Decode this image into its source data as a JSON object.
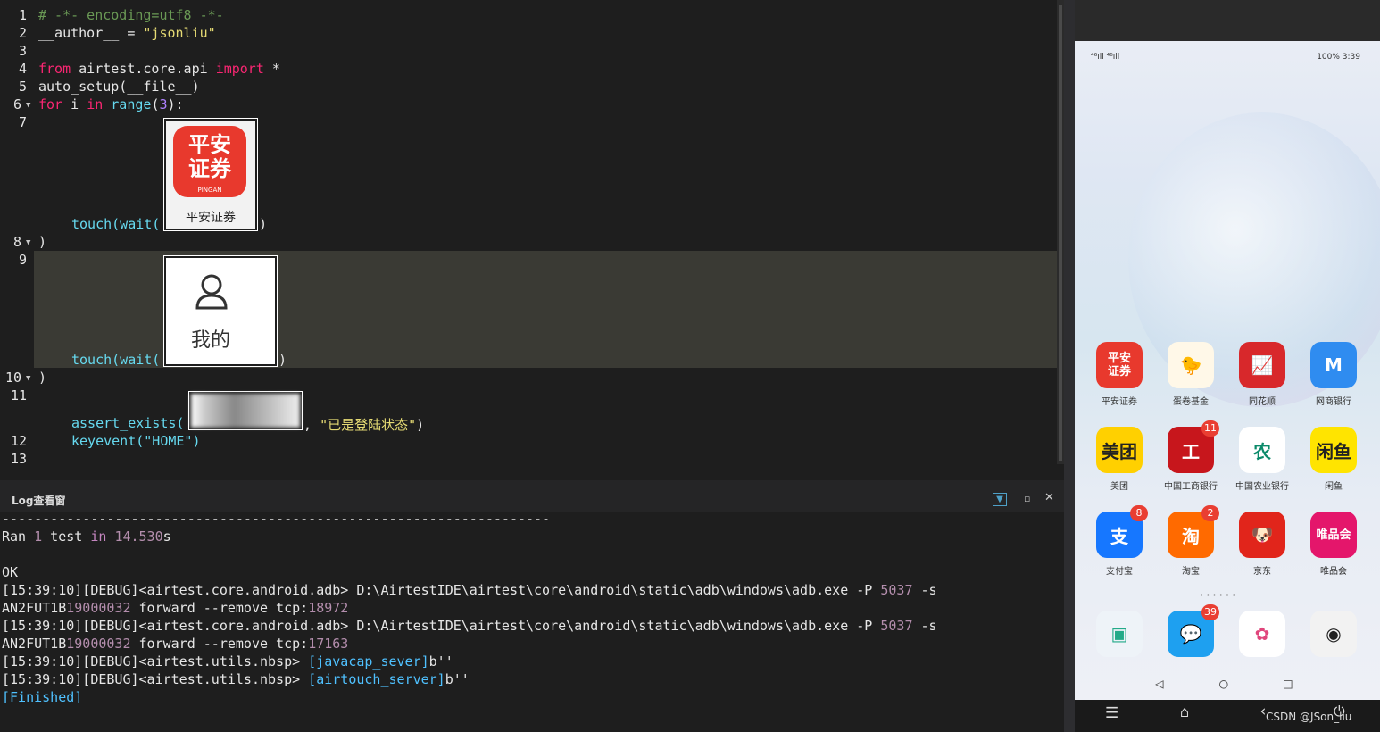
{
  "editor": {
    "line_numbers": [
      "1",
      "2",
      "3",
      "4",
      "5",
      "6",
      "7",
      "8",
      "9",
      "10",
      "11",
      "12",
      "13"
    ],
    "l1": "# -*- encoding=utf8 -*-",
    "l2a": "__author__ = ",
    "l2b": "\"jsonliu\"",
    "l4a": "from",
    "l4b": " airtest.core.api ",
    "l4c": "import",
    "l4d": " *",
    "l5": "auto_setup(__file__)",
    "l6a": "for",
    "l6b": " i ",
    "l6c": "in",
    "l6d": " range",
    "l6e": "(",
    "l6f": "3",
    "l6g": "):",
    "touch": "touch",
    "wait": "(wait(",
    "close": ")",
    "paren": ")",
    "assert": "assert_exists(",
    "assert_msg": "\"已是登陆状态\"",
    "assert_end": ")",
    "comma": ", ",
    "keyevent": "keyevent(\"HOME\")",
    "img1_text": "平安证券",
    "img1_icon": "平安\n证券",
    "img1_sub": "PINGAN",
    "img2_text": "我的"
  },
  "log": {
    "title": "Log查看窗",
    "dashes": "--------------------------------------------------------------------",
    "ran_a": "Ran ",
    "ran_b": "1",
    "ran_c": " test ",
    "ran_d": "in",
    "ran_e": " ",
    "ran_f": "14.530",
    "ran_g": "s",
    "ok": "OK",
    "l1a": "[15:39:10][DEBUG]<airtest.core.android.adb> D:\\AirtestIDE\\airtest\\core\\android\\static\\adb\\windows\\adb.exe -P ",
    "l1b": "5037",
    "l1c": " -s",
    "l2a": "AN2FUT1B",
    "l2b": "19000032",
    "l2c": " forward --remove tcp:",
    "l2d": "18972",
    "l3a": "[15:39:10][DEBUG]<airtest.core.android.adb> D:\\AirtestIDE\\airtest\\core\\android\\static\\adb\\windows\\adb.exe -P ",
    "l3b": "5037",
    "l3c": " -s",
    "l4a": "AN2FUT1B",
    "l4b": "19000032",
    "l4c": " forward --remove tcp:",
    "l4d": "17163",
    "l5a": "[15:39:10][DEBUG]<airtest.utils.nbsp> ",
    "l5b": "[javacap_sever]",
    "l5c": "b''",
    "l6a": "[15:39:10][DEBUG]<airtest.utils.nbsp> ",
    "l6b": "[airtouch_server]",
    "l6c": "b''",
    "finished": "[Finished]"
  },
  "phone": {
    "status_left": "⁴⁶ıll ⁴⁶ıll",
    "status_right": "100%  3:39",
    "apps": [
      {
        "label": "平安证券",
        "icon": "平安\n证券",
        "bg": "#e8392d",
        "fg": "#fff"
      },
      {
        "label": "蛋卷基金",
        "icon": "🐤",
        "bg": "#fff8e8",
        "fg": "#f5c400"
      },
      {
        "label": "同花顺",
        "icon": "📈",
        "bg": "#d8282b",
        "fg": "#fff"
      },
      {
        "label": "网商银行",
        "icon": "M",
        "bg": "#2f8cf0",
        "fg": "#fff"
      },
      {
        "label": "美团",
        "icon": "美团",
        "bg": "#ffd000",
        "fg": "#222"
      },
      {
        "label": "中国工商银行",
        "icon": "工",
        "bg": "#c7161c",
        "fg": "#fff",
        "badge": "11"
      },
      {
        "label": "中国农业银行",
        "icon": "农",
        "bg": "#ffffff",
        "fg": "#0b8a6a"
      },
      {
        "label": "闲鱼",
        "icon": "闲鱼",
        "bg": "#ffe400",
        "fg": "#222"
      },
      {
        "label": "支付宝",
        "icon": "支",
        "bg": "#1677ff",
        "fg": "#fff",
        "badge": "8"
      },
      {
        "label": "淘宝",
        "icon": "淘",
        "bg": "#ff6a00",
        "fg": "#fff",
        "badge": "2"
      },
      {
        "label": "京东",
        "icon": "🐶",
        "bg": "#e1251b",
        "fg": "#fff"
      },
      {
        "label": "唯品会",
        "icon": "唯品会",
        "bg": "#e4166b",
        "fg": "#fff"
      }
    ],
    "dock": [
      {
        "label": "",
        "icon": "▣",
        "bg": "#eef3f8",
        "fg": "#2a8"
      },
      {
        "label": "",
        "icon": "💬",
        "bg": "#1ea0f0",
        "fg": "#fff",
        "badge": "39"
      },
      {
        "label": "",
        "icon": "✿",
        "bg": "#ffffff",
        "fg": "#e0457b"
      },
      {
        "label": "",
        "icon": "◉",
        "bg": "#f2f2f2",
        "fg": "#222"
      }
    ],
    "watermark": "CSDN @JSon_liu"
  }
}
